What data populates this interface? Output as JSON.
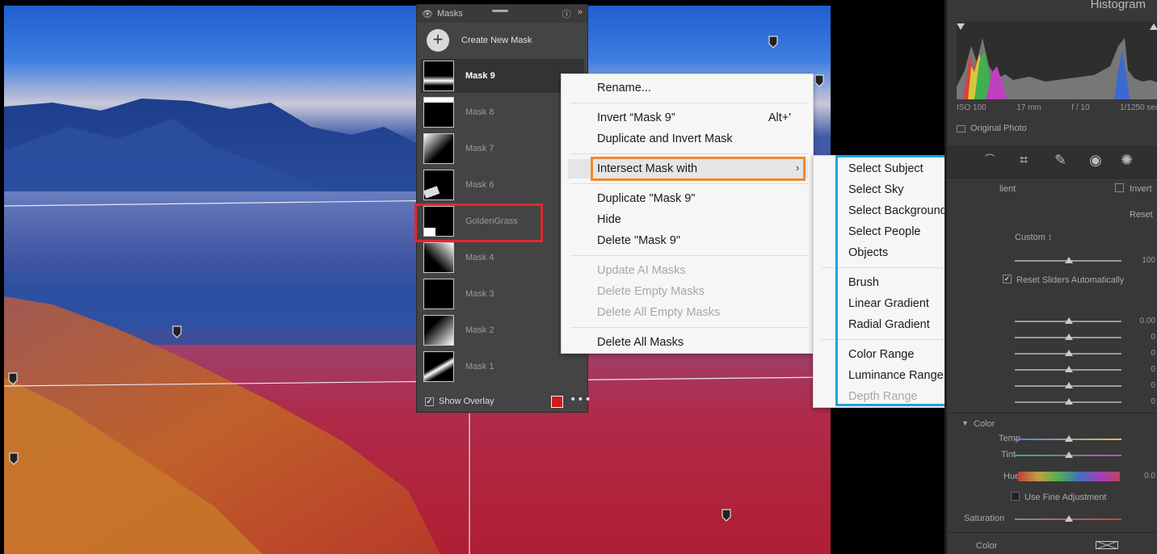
{
  "masks_panel": {
    "title": "Masks",
    "create_label": "Create New Mask",
    "items": [
      {
        "label": "Mask 9"
      },
      {
        "label": "Mask 8"
      },
      {
        "label": "Mask 7"
      },
      {
        "label": "Mask 6"
      },
      {
        "label": "GoldenGrass"
      },
      {
        "label": "Mask 4"
      },
      {
        "label": "Mask 3"
      },
      {
        "label": "Mask 2"
      },
      {
        "label": "Mask 1"
      }
    ],
    "selected": "Mask 9",
    "show_overlay_label": "Show Overlay",
    "show_overlay_checked": true,
    "overlay_color": "#d41a1a"
  },
  "context_menu": {
    "rename": "Rename...",
    "invert": "Invert “Mask 9”",
    "invert_shortcut": "Alt+'",
    "duplicate_invert": "Duplicate and Invert Mask",
    "intersect": "Intersect Mask with",
    "duplicate": "Duplicate \"Mask 9\"",
    "hide": "Hide",
    "delete": "Delete \"Mask 9\"",
    "update_ai": "Update AI Masks",
    "delete_empty": "Delete Empty Masks",
    "delete_all_empty": "Delete All Empty Masks",
    "delete_all": "Delete All Masks"
  },
  "submenu": {
    "select_subject": "Select Subject",
    "select_sky": "Select Sky",
    "select_background": "Select Background",
    "select_people": "Select People",
    "objects": "Objects",
    "brush": "Brush",
    "linear_gradient": "Linear Gradient",
    "radial_gradient": "Radial Gradient",
    "color_range": "Color Range",
    "luminance_range": "Luminance Range",
    "depth_range": "Depth Range"
  },
  "right_panel": {
    "histogram_title": "Histogram",
    "iso": "ISO 100",
    "focal": "17 mm",
    "aperture": "f / 10",
    "shutter": "1/1250 sec",
    "original_photo": "Original Photo",
    "lient": "lient",
    "invert": "Invert",
    "reset": "Reset",
    "custom": "Custom ↕",
    "val_100": "100",
    "reset_sliders": "Reset Sliders Automatically",
    "val_000": "0.00",
    "zeros": [
      "0",
      "0",
      "0",
      "0",
      "0"
    ],
    "color_section": "Color",
    "temp": "Temp",
    "tint": "Tint",
    "hue": "Hue",
    "hue_val": "0.0",
    "use_fine": "Use Fine Adjustment",
    "saturation": "Saturation",
    "color_label": "Color"
  },
  "colors": {
    "highlight_red": "#e0282d",
    "highlight_orange": "#f08a2c",
    "highlight_blue": "#1aa3de"
  }
}
